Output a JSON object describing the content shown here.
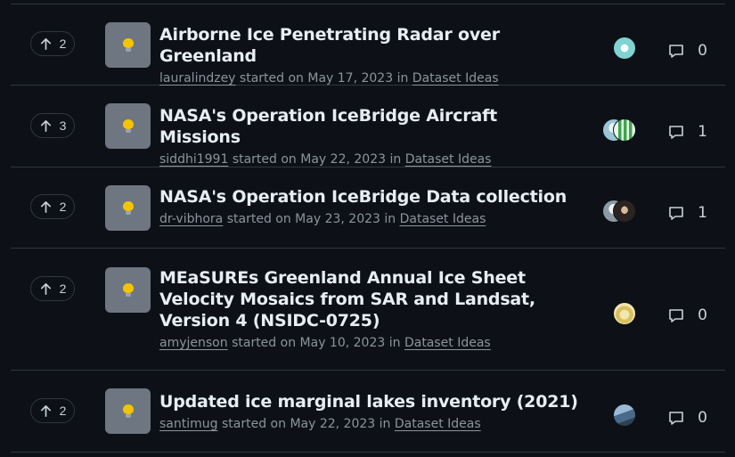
{
  "discussions": [
    {
      "votes": "2",
      "title": "Airborne Ice Penetrating Radar over Greenland",
      "author": "lauralindzey",
      "started_text": "started on",
      "date": "May 17, 2023",
      "in_text": "in",
      "category": "Dataset Ideas",
      "comments": "0"
    },
    {
      "votes": "3",
      "title": "NASA's Operation IceBridge Aircraft Missions",
      "author": "siddhi1991",
      "started_text": "started on",
      "date": "May 22, 2023",
      "in_text": "in",
      "category": "Dataset Ideas",
      "comments": "1"
    },
    {
      "votes": "2",
      "title": "NASA's Operation IceBridge Data collection",
      "author": "dr-vibhora",
      "started_text": "started on",
      "date": "May 23, 2023",
      "in_text": "in",
      "category": "Dataset Ideas",
      "comments": "1"
    },
    {
      "votes": "2",
      "title": "MEaSUREs Greenland Annual Ice Sheet Velocity Mosaics from SAR and Landsat, Version 4 (NSIDC-0725)",
      "author": "amyjenson",
      "started_text": "started on",
      "date": "May 10, 2023",
      "in_text": "in",
      "category": "Dataset Ideas",
      "comments": "0"
    },
    {
      "votes": "2",
      "title": "Updated ice marginal lakes inventory (2021)",
      "author": "santimug",
      "started_text": "started on",
      "date": "May 22, 2023",
      "in_text": "in",
      "category": "Dataset Ideas",
      "comments": "0"
    }
  ],
  "icons": {
    "upvote": "arrow-up-icon",
    "category": "light-bulb-icon",
    "comments": "comment-icon"
  },
  "colors": {
    "background": "#0d1117",
    "border": "#30363d",
    "title": "#e6edf3",
    "muted": "#8b949e",
    "category_icon_bg": "#6e7681"
  }
}
